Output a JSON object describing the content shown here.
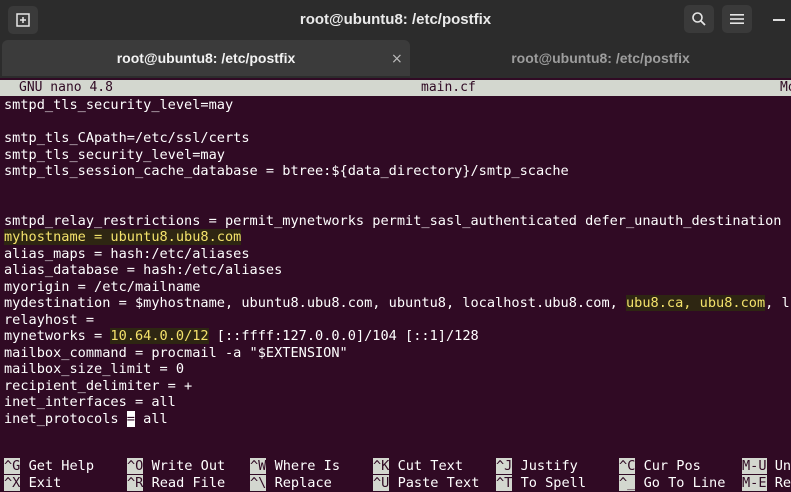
{
  "window": {
    "title": "root@ubuntu8: /etc/postfix",
    "icons": {
      "new_tab": "new-tab-icon",
      "search": "search-icon",
      "menu": "hamburger-menu-icon",
      "minimize": "minimize-icon"
    }
  },
  "tabs": [
    {
      "label": "root@ubuntu8: /etc/postfix",
      "active": true,
      "close": "×"
    },
    {
      "label": "root@ubuntu8: /etc/postfix",
      "active": false
    }
  ],
  "nano": {
    "version": "GNU nano 4.8",
    "filename": "main.cf",
    "status_right": "Mo"
  },
  "lines": [
    "smtpd_tls_security_level=may",
    "",
    "smtp_tls_CApath=/etc/ssl/certs",
    "smtp_tls_security_level=may",
    "smtp_tls_session_cache_database = btree:${data_directory}/smtp_scache",
    "",
    "",
    "smtpd_relay_restrictions = permit_mynetworks permit_sasl_authenticated defer_unauth_destination",
    "myhostname = ubuntu8.ubu8.com",
    "alias_maps = hash:/etc/aliases",
    "alias_database = hash:/etc/aliases",
    "myorigin = /etc/mailname",
    {
      "a": "mydestination = $myhostname, ubuntu8.ubu8.com, ubuntu8, localhost.ubu8.com, ",
      "b": "ubu8.ca, ubu8.com",
      "c": ", l"
    },
    "relayhost =",
    {
      "a": "mynetworks = ",
      "b": "10.64.0.0/12",
      "c": " [::ffff:127.0.0.0]/104 [::1]/128"
    },
    "mailbox_command = procmail -a \"$EXTENSION\"",
    "mailbox_size_limit = 0",
    "recipient_delimiter = +",
    "inet_interfaces = all",
    {
      "a": "inet_protocols ",
      "cursor": "=",
      "c": " all"
    }
  ],
  "shortcuts": [
    [
      {
        "key": "^G",
        "label": "Get Help"
      },
      {
        "key": "^O",
        "label": "Write Out"
      },
      {
        "key": "^W",
        "label": "Where Is"
      },
      {
        "key": "^K",
        "label": "Cut Text"
      },
      {
        "key": "^J",
        "label": "Justify"
      },
      {
        "key": "^C",
        "label": "Cur Pos"
      },
      {
        "key": "M-U",
        "label": "Und"
      }
    ],
    [
      {
        "key": "^X",
        "label": "Exit"
      },
      {
        "key": "^R",
        "label": "Read File"
      },
      {
        "key": "^\\",
        "label": "Replace"
      },
      {
        "key": "^U",
        "label": "Paste Text"
      },
      {
        "key": "^T",
        "label": "To Spell"
      },
      {
        "key": "^_",
        "label": "Go To Line"
      },
      {
        "key": "M-E",
        "label": "Red"
      }
    ]
  ]
}
